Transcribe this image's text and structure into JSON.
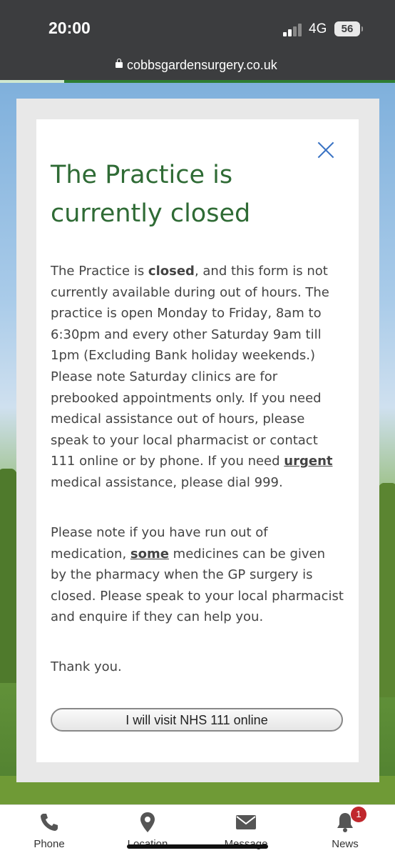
{
  "status_bar": {
    "time": "20:00",
    "network": "4G",
    "battery": "56"
  },
  "browser": {
    "url": "cobbsgardensurgery.co.uk"
  },
  "modal": {
    "title": "The Practice is currently closed",
    "p1_a": "The Practice is ",
    "p1_b": "closed",
    "p1_c": ", and this form is not currently available during out of hours. The practice is open Monday to Friday, 8am to 6:30pm and every other Saturday 9am till 1pm (Excluding Bank holiday weekends.) Please note Saturday clinics are for prebooked appointments only. If you need medical assistance out of hours, please speak to your local pharmacist or contact 111 online or by phone. If you need ",
    "p1_d": "urgent ",
    "p1_e": "medical assistance, please dial 999.",
    "p2_a": "Please note if you have run out of medication, ",
    "p2_b": "some",
    "p2_c": " medicines can be given by the pharmacy when the GP surgery is closed. Please speak to your local pharmacist and enquire if they can help you.",
    "p3": "Thank you.",
    "button": "I will visit NHS 111 online"
  },
  "nav": {
    "items": [
      {
        "label": "Phone",
        "icon": "phone-icon"
      },
      {
        "label": "Location",
        "icon": "location-pin-icon"
      },
      {
        "label": "Message",
        "icon": "envelope-icon"
      },
      {
        "label": "News",
        "icon": "bell-icon",
        "badge": "1"
      }
    ]
  },
  "colors": {
    "title_green": "#2f6b35",
    "close_blue": "#3a73c4",
    "badge_red": "#c0272d",
    "progress_green": "#2e7d32"
  }
}
